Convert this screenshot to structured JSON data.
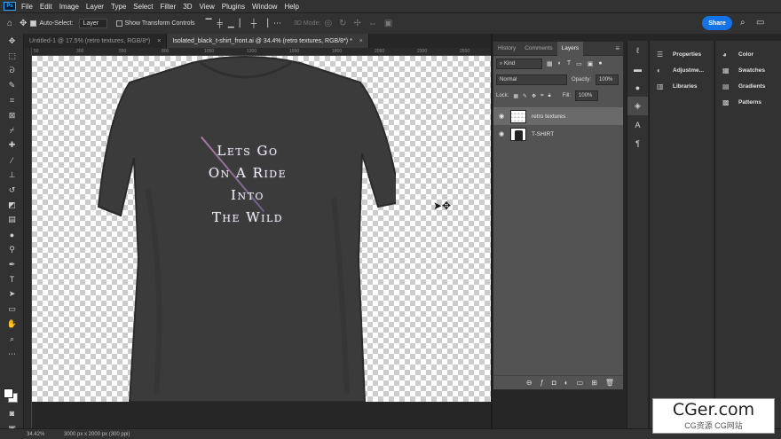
{
  "menu": {
    "logo": "Ps",
    "items": [
      "File",
      "Edit",
      "Image",
      "Layer",
      "Type",
      "Select",
      "Filter",
      "3D",
      "View",
      "Plugins",
      "Window",
      "Help"
    ]
  },
  "options": {
    "auto_select_label": "Auto-Select:",
    "auto_select_value": "Layer",
    "show_transform_label": "Show Transform Controls",
    "mode_3d_label": "3D Mode:",
    "share_label": "Share"
  },
  "tabs": [
    {
      "label": "Untitled-1 @ 17.5% (retro textures, RGB/8*)",
      "close": "×",
      "active": false
    },
    {
      "label": "Isolated_black_t-shirt_front.ai @ 34.4% (retro textures, RGB/8*) *",
      "close": "×",
      "active": true
    }
  ],
  "ruler_ticks": [
    "50",
    "100",
    "150",
    "200",
    "250",
    "300",
    "350",
    "400",
    "450",
    "500",
    "550",
    "600",
    "650",
    "700",
    "750",
    "800",
    "850",
    "900",
    "950",
    "1000",
    "1050",
    "1100",
    "1150",
    "1200",
    "1250",
    "1300",
    "1350",
    "1400",
    "1450",
    "1500",
    "1550",
    "1600",
    "1650",
    "1700",
    "1750",
    "1800",
    "1850",
    "1900",
    "1950",
    "2000",
    "2050",
    "2100",
    "2150",
    "2200",
    "2250",
    "2300",
    "2350",
    "2400",
    "2450",
    "2500",
    "2550",
    "2600",
    "2650",
    "2700"
  ],
  "print": {
    "lines": [
      "Lets Go",
      "On A Ride",
      "Into",
      "The Wild"
    ]
  },
  "layers_panel": {
    "tabs": [
      "History",
      "Comments",
      "Layers"
    ],
    "kind_label": "Kind",
    "blend_mode": "Normal",
    "opacity_label": "Opacity:",
    "opacity_value": "100%",
    "lock_label": "Lock:",
    "fill_label": "Fill:",
    "fill_value": "100%",
    "layers": [
      {
        "name": "retro textures",
        "selected": true
      },
      {
        "name": "T-SHIRT",
        "selected": false
      }
    ]
  },
  "props_column": [
    "Properties",
    "Adjustme...",
    "Libraries"
  ],
  "color_column": [
    "Color",
    "Swatches",
    "Gradients",
    "Patterns"
  ],
  "status": {
    "zoom": "34.42%",
    "doc": "3000 px x 2000 px (300 ppi)"
  },
  "watermark": {
    "big": "CGer.com",
    "small": "CG资源 CG网站"
  }
}
